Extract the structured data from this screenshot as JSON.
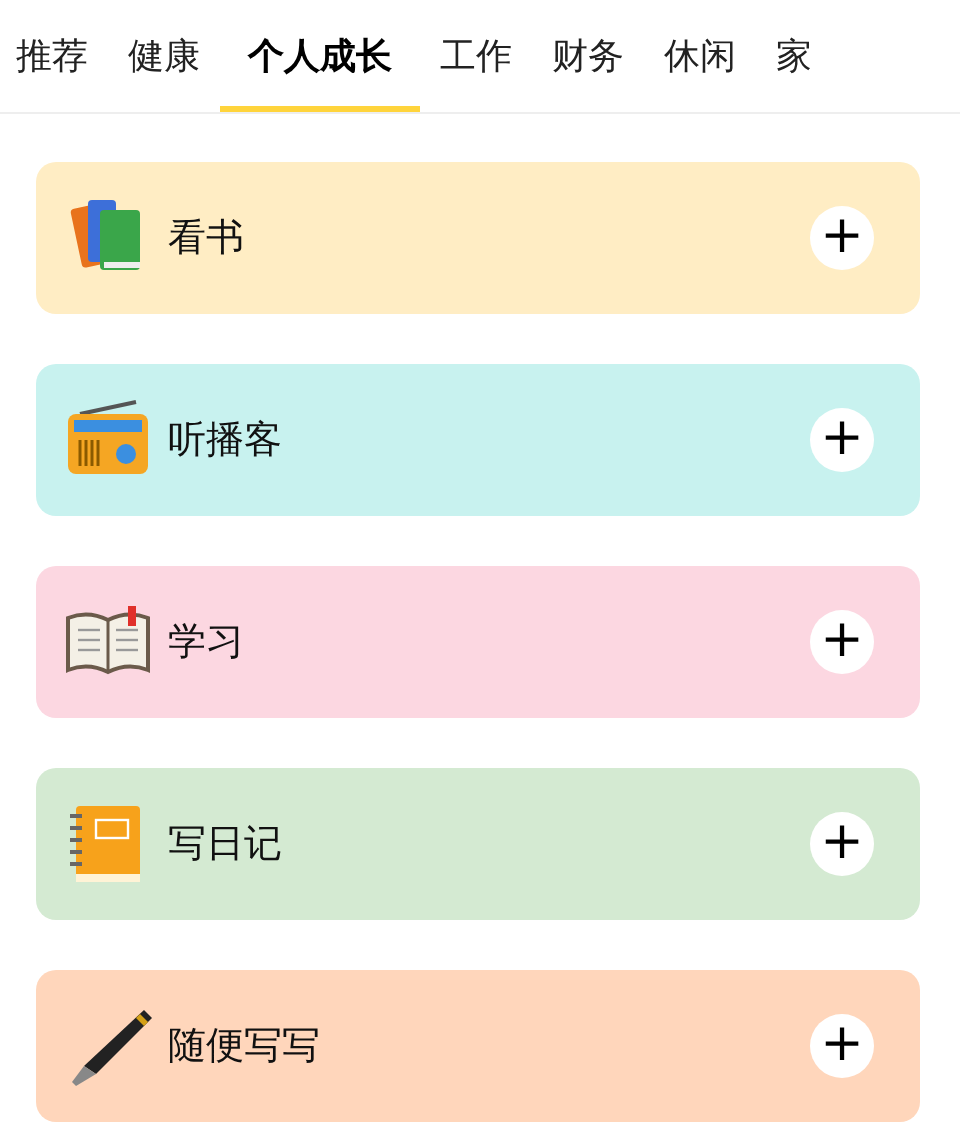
{
  "tabs": [
    {
      "label": "推荐",
      "selected": false
    },
    {
      "label": "健康",
      "selected": false
    },
    {
      "label": "个人成长",
      "selected": true
    },
    {
      "label": "工作",
      "selected": false
    },
    {
      "label": "财务",
      "selected": false
    },
    {
      "label": "休闲",
      "selected": false
    },
    {
      "label": "家",
      "selected": false
    }
  ],
  "items": [
    {
      "label": "看书",
      "kind": "books",
      "color": "#ffedc4",
      "add": "+"
    },
    {
      "label": "听播客",
      "kind": "radio",
      "color": "#c8f2ef",
      "add": "+"
    },
    {
      "label": "学习",
      "kind": "openbook",
      "color": "#fcd7e1",
      "add": "+"
    },
    {
      "label": "写日记",
      "kind": "notebook",
      "color": "#d4ead2",
      "add": "+"
    },
    {
      "label": "随便写写",
      "kind": "pen",
      "color": "#ffd6bb",
      "add": "+"
    }
  ]
}
